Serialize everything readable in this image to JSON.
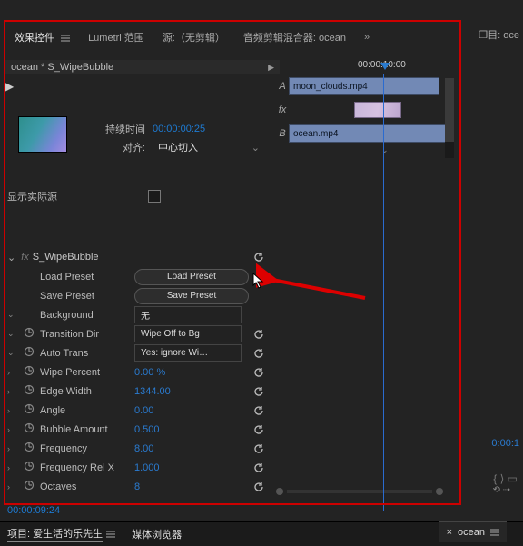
{
  "tabs": {
    "effect_controls": "效果控件",
    "lumetri": "Lumetri 范围",
    "source": "源:（无剪辑）",
    "audio_mixer": "音频剪辑混合器: ocean",
    "more": "»",
    "right_panel": "❐目: oce"
  },
  "clip_line": "ocean * S_WipeBubble",
  "duration": {
    "label": "持续时间",
    "value": "00:00:00:25",
    "align_label": "对齐:",
    "align_value": "中心切入"
  },
  "show_actual_source": "显示实际源",
  "effect": {
    "name": "S_WipeBubble",
    "rows": [
      {
        "label": "Load Preset",
        "kind": "pill",
        "value": "Load Preset"
      },
      {
        "label": "Save Preset",
        "kind": "pill",
        "value": "Save Preset"
      },
      {
        "label": "Background",
        "kind": "dd",
        "value": "无"
      },
      {
        "label": "Transition Dir",
        "kind": "dd",
        "value": "Wipe Off to Bg",
        "sw": true,
        "reset": true
      },
      {
        "label": "Auto Trans",
        "kind": "dd",
        "value": "Yes: ignore Wi…",
        "sw": true,
        "reset": true
      },
      {
        "label": "Wipe Percent",
        "kind": "val",
        "value": "0.00 %",
        "sw": true,
        "reset": true,
        "chev": true
      },
      {
        "label": "Edge Width",
        "kind": "val",
        "value": "1344.00",
        "sw": true,
        "reset": true,
        "chev": true
      },
      {
        "label": "Angle",
        "kind": "val",
        "value": "0.00",
        "sw": true,
        "reset": true,
        "chev": true
      },
      {
        "label": "Bubble Amount",
        "kind": "val",
        "value": "0.500",
        "sw": true,
        "reset": true,
        "chev": true
      },
      {
        "label": "Frequency",
        "kind": "val",
        "value": "8.00",
        "sw": true,
        "reset": true,
        "chev": true
      },
      {
        "label": "Frequency Rel X",
        "kind": "val",
        "value": "1.000",
        "sw": true,
        "reset": true,
        "chev": true
      },
      {
        "label": "Octaves",
        "kind": "val",
        "value": "8",
        "sw": true,
        "reset": true,
        "chev": true
      }
    ]
  },
  "timeline": {
    "ruler": "00:00:10:00",
    "trackA": "A",
    "clipA": "moon_clouds.mp4",
    "fx": "fx",
    "trackB": "B",
    "clipB": "ocean.mp4"
  },
  "timecode_bottom": "00:00:09:24",
  "footer": {
    "project": "项目: 爱生活的乐先生",
    "media_browser": "媒体浏览器",
    "tab_ocean": "ocean"
  },
  "rstrip_tc": "0:00:1",
  "bot_rt": "⟲  ⇢"
}
